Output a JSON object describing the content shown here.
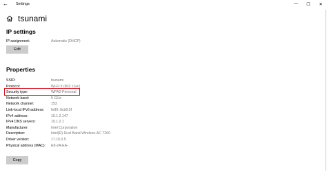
{
  "window": {
    "title": "Settings",
    "back_glyph": "←",
    "controls": [
      "—",
      "☐",
      "✕"
    ]
  },
  "page": {
    "title": "tsunami",
    "icon": "home-icon"
  },
  "ip_settings": {
    "heading": "IP settings",
    "assignment_label": "IP assignment:",
    "assignment_value": "Automatic (DHCP)",
    "edit_label": "Edit"
  },
  "properties": {
    "heading": "Properties",
    "rows": [
      {
        "label": "SSID:",
        "value": "tsunami"
      },
      {
        "label": "Protocol:",
        "value": "Wi-Fi 5 (802.11ac)"
      },
      {
        "label": "Security type:",
        "value": "WPA2-Personal"
      },
      {
        "label": "Network band:",
        "value": "5 GHz"
      },
      {
        "label": "Network channel:",
        "value": "153"
      },
      {
        "label": "Link-local IPv6 address:",
        "value": "fe80::9cb9:2f"
      },
      {
        "label": "IPv4 address:",
        "value": "10.1.2.147"
      },
      {
        "label": "IPv4 DNS servers:",
        "value": "10.1.2.1"
      },
      {
        "label": "Manufacturer:",
        "value": "Intel Corporation"
      },
      {
        "label": "Description:",
        "value": "Intel(R) Dual Band Wireless-AC 7260"
      },
      {
        "label": "Driver version:",
        "value": "17.15.0.5"
      },
      {
        "label": "Physical address (MAC):",
        "value": "E8-2A-EA-"
      }
    ],
    "copy_label": "Copy"
  },
  "colors": {
    "highlight": "#d4111d",
    "value_text": "#767676",
    "button_bg": "#cccccc"
  }
}
